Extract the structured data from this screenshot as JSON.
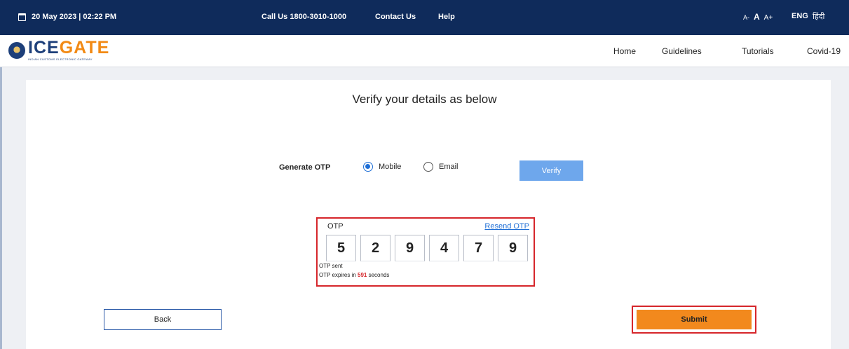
{
  "topbar": {
    "datetime": "20 May 2023 | 02:22 PM",
    "call_us": "Call Us  1800-3010-1000",
    "contact_us": "Contact Us",
    "help": "Help",
    "font_small": "A-",
    "font_normal": "A",
    "font_large": "A+",
    "lang_en": "ENG",
    "lang_hi": "हिंदी"
  },
  "logo": {
    "text_part1": "ICE",
    "text_part2": "GATE",
    "tagline": "INDIAN CUSTOMS ELECTRONIC GATEWAY"
  },
  "nav": {
    "home": "Home",
    "guidelines": "Guidelines",
    "tutorials": "Tutorials",
    "covid": "Covid-19"
  },
  "main": {
    "title": "Verify your details as below",
    "generate_otp_label": "Generate OTP",
    "radio_mobile": "Mobile",
    "radio_email": "Email",
    "selected_option": "Mobile",
    "verify_label": "Verify"
  },
  "otp": {
    "label": "OTP",
    "resend_label": "Resend OTP",
    "digits": [
      "5",
      "2",
      "9",
      "4",
      "7",
      "9"
    ],
    "sent_text": "OTP sent",
    "expires_prefix": "OTP expires in",
    "expires_seconds": "591",
    "expires_suffix": "seconds"
  },
  "actions": {
    "back_label": "Back",
    "submit_label": "Submit"
  },
  "colors": {
    "header_bg": "#0f2b5b",
    "accent_blue": "#1f6fd6",
    "verify_bg": "#6ea7ec",
    "submit_bg": "#f2891d",
    "highlight_red": "#d6262b"
  }
}
